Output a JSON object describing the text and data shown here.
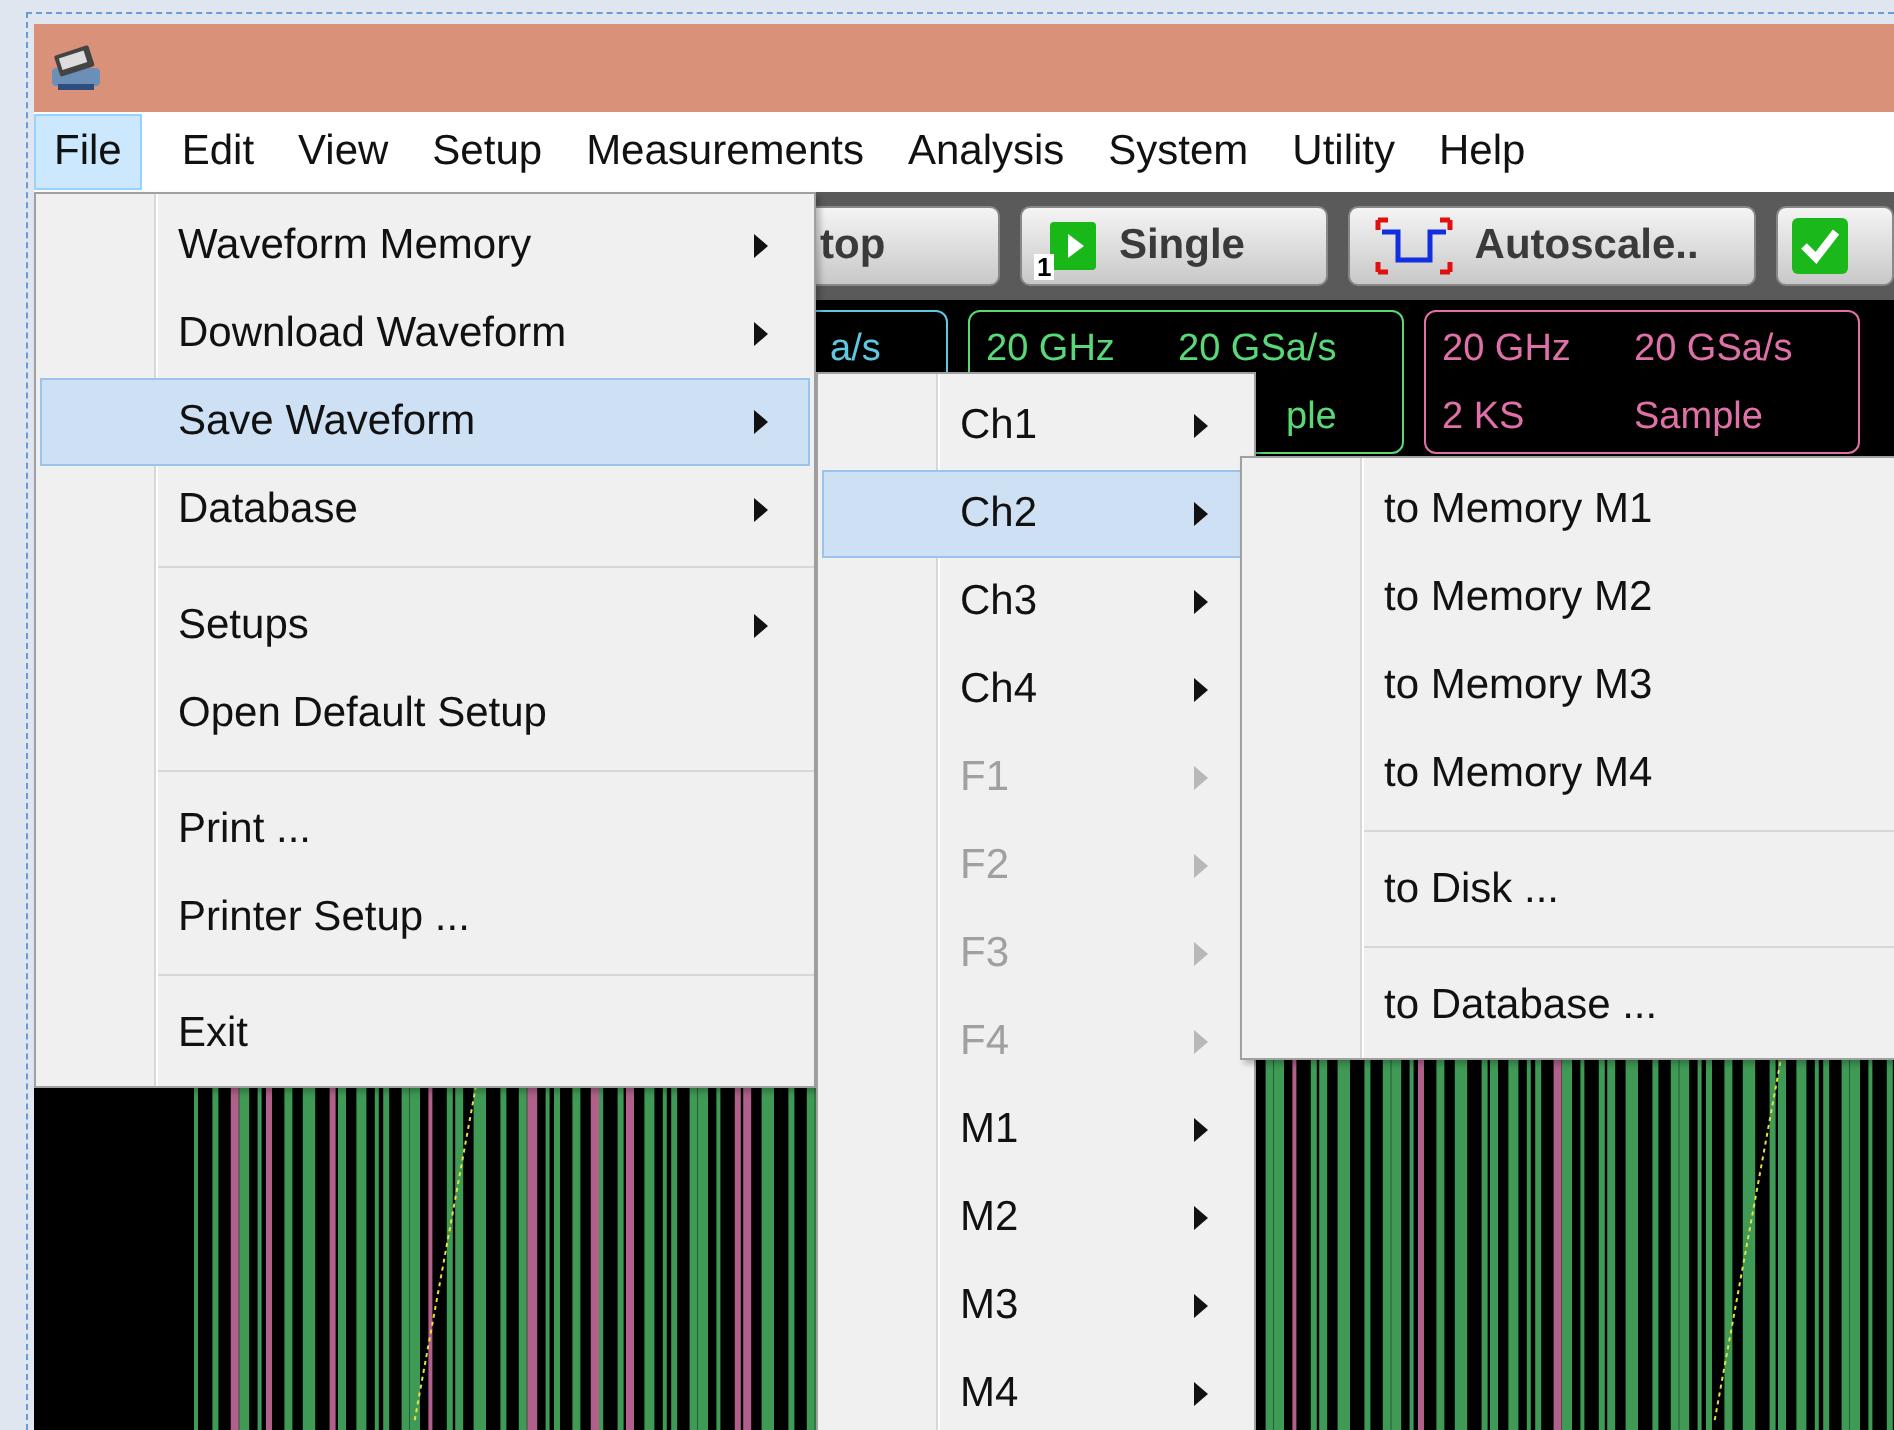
{
  "menu_bar": [
    {
      "label": "File",
      "selected": true
    },
    {
      "label": "Edit",
      "selected": false
    },
    {
      "label": "View",
      "selected": false
    },
    {
      "label": "Setup",
      "selected": false
    },
    {
      "label": "Measurements",
      "selected": false
    },
    {
      "label": "Analysis",
      "selected": false
    },
    {
      "label": "System",
      "selected": false
    },
    {
      "label": "Utility",
      "selected": false
    },
    {
      "label": "Help",
      "selected": false
    }
  ],
  "toolbar": [
    {
      "kind": "text",
      "label": "top"
    },
    {
      "kind": "single",
      "label": "Single",
      "badge": "1"
    },
    {
      "kind": "autoscale",
      "label": "Autoscale.."
    },
    {
      "kind": "check"
    }
  ],
  "channel_boxes": [
    {
      "color": "#5fc8e0",
      "top": [
        "a/s"
      ]
    },
    {
      "color": "#58d878",
      "top": [
        "20 GHz",
        "20 GSa/s"
      ],
      "bottom": [
        "ple"
      ]
    },
    {
      "color": "#e070a8",
      "top": [
        "20 GHz",
        "20 GSa/s"
      ],
      "bottom": [
        "2 KS",
        "Sample"
      ]
    }
  ],
  "file_menu": [
    {
      "kind": "item",
      "label": "Waveform Memory",
      "submenu": true,
      "selected": false,
      "disabled": false
    },
    {
      "kind": "item",
      "label": "Download Waveform",
      "submenu": true,
      "selected": false,
      "disabled": false
    },
    {
      "kind": "item",
      "label": "Save Waveform",
      "submenu": true,
      "selected": true,
      "disabled": false
    },
    {
      "kind": "item",
      "label": "Database",
      "submenu": true,
      "selected": false,
      "disabled": false
    },
    {
      "kind": "separator"
    },
    {
      "kind": "item",
      "label": "Setups",
      "submenu": true,
      "selected": false,
      "disabled": false
    },
    {
      "kind": "item",
      "label": "Open Default Setup",
      "submenu": false,
      "selected": false,
      "disabled": false
    },
    {
      "kind": "separator"
    },
    {
      "kind": "item",
      "label": "Print ...",
      "submenu": false,
      "selected": false,
      "disabled": false
    },
    {
      "kind": "item",
      "label": "Printer Setup ...",
      "submenu": false,
      "selected": false,
      "disabled": false
    },
    {
      "kind": "separator"
    },
    {
      "kind": "item",
      "label": "Exit",
      "submenu": false,
      "selected": false,
      "disabled": false
    }
  ],
  "save_waveform_menu": [
    {
      "kind": "item",
      "label": "Ch1",
      "submenu": true,
      "selected": false,
      "disabled": false
    },
    {
      "kind": "item",
      "label": "Ch2",
      "submenu": true,
      "selected": true,
      "disabled": false
    },
    {
      "kind": "item",
      "label": "Ch3",
      "submenu": true,
      "selected": false,
      "disabled": false
    },
    {
      "kind": "item",
      "label": "Ch4",
      "submenu": true,
      "selected": false,
      "disabled": false
    },
    {
      "kind": "item",
      "label": "F1",
      "submenu": true,
      "selected": false,
      "disabled": true
    },
    {
      "kind": "item",
      "label": "F2",
      "submenu": true,
      "selected": false,
      "disabled": true
    },
    {
      "kind": "item",
      "label": "F3",
      "submenu": true,
      "selected": false,
      "disabled": true
    },
    {
      "kind": "item",
      "label": "F4",
      "submenu": true,
      "selected": false,
      "disabled": true
    },
    {
      "kind": "item",
      "label": "M1",
      "submenu": true,
      "selected": false,
      "disabled": false
    },
    {
      "kind": "item",
      "label": "M2",
      "submenu": true,
      "selected": false,
      "disabled": false
    },
    {
      "kind": "item",
      "label": "M3",
      "submenu": true,
      "selected": false,
      "disabled": false
    },
    {
      "kind": "item",
      "label": "M4",
      "submenu": true,
      "selected": false,
      "disabled": false
    }
  ],
  "ch2_menu": [
    {
      "kind": "item",
      "label": "to Memory M1",
      "submenu": false,
      "selected": false,
      "disabled": false
    },
    {
      "kind": "item",
      "label": "to Memory M2",
      "submenu": false,
      "selected": false,
      "disabled": false
    },
    {
      "kind": "item",
      "label": "to Memory M3",
      "submenu": false,
      "selected": false,
      "disabled": false
    },
    {
      "kind": "item",
      "label": "to Memory M4",
      "submenu": false,
      "selected": false,
      "disabled": false
    },
    {
      "kind": "separator"
    },
    {
      "kind": "item",
      "label": "to Disk ...",
      "submenu": false,
      "selected": false,
      "disabled": false
    },
    {
      "kind": "separator"
    },
    {
      "kind": "item",
      "label": "to Database ...",
      "submenu": false,
      "selected": false,
      "disabled": false
    }
  ]
}
